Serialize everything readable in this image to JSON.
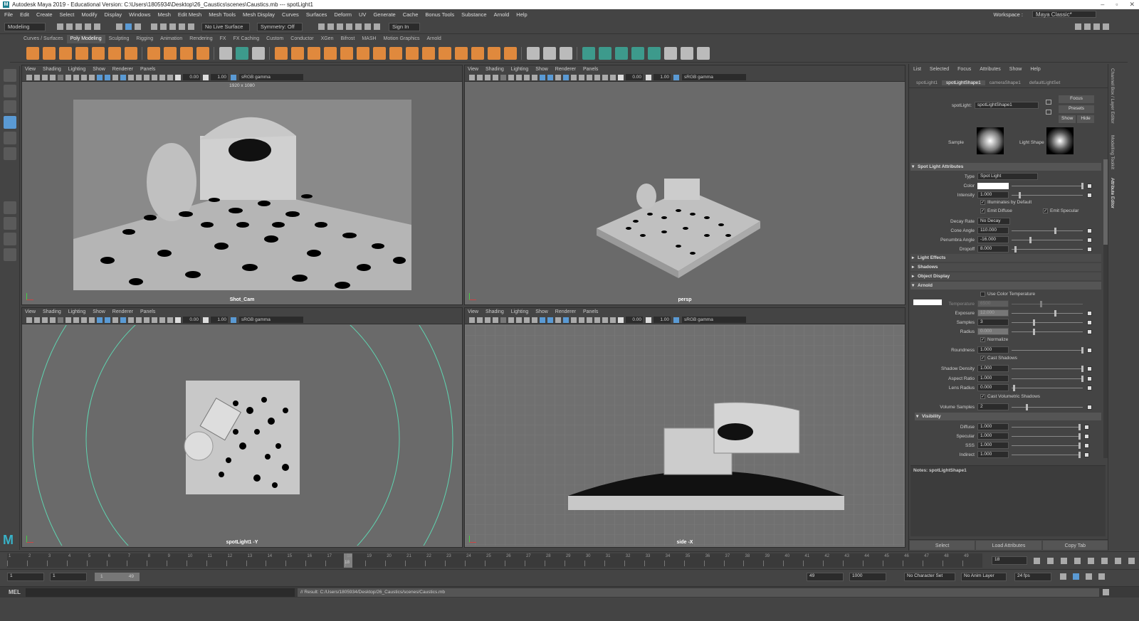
{
  "title": "Autodesk Maya 2019 - Educational Version: C:\\Users\\1805934\\Desktop\\26_Caustics\\scenes\\Caustics.mb  ---  spotLight1",
  "menus": [
    "File",
    "Edit",
    "Create",
    "Select",
    "Modify",
    "Display",
    "Windows",
    "Mesh",
    "Edit Mesh",
    "Mesh Tools",
    "Mesh Display",
    "Curves",
    "Surfaces",
    "Deform",
    "UV",
    "Generate",
    "Cache",
    "Bonus Tools",
    "Substance",
    "Arnold",
    "Help"
  ],
  "workspace": {
    "label": "Workspace :",
    "value": "Maya Classic*"
  },
  "status": {
    "mode": "Modeling",
    "live": "No Live Surface",
    "symmetry": "Symmetry: Off",
    "signin": "Sign In"
  },
  "shelf_tabs": [
    "Curves / Surfaces",
    "Poly Modeling",
    "Sculpting",
    "Rigging",
    "Animation",
    "Rendering",
    "FX",
    "FX Caching",
    "Custom",
    "Conductor",
    "XGen",
    "Bifrost",
    "MASH",
    "Motion Graphics",
    "Arnold"
  ],
  "viewport": {
    "menu": [
      "View",
      "Shading",
      "Lighting",
      "Show",
      "Renderer",
      "Panels"
    ],
    "value1": "0.00",
    "value2": "1.00",
    "gamma": "sRGB gamma",
    "panels": [
      {
        "label": "Shot_Cam",
        "res": "1920 x 1080"
      },
      {
        "label": "persp"
      },
      {
        "label": "spotLight1 -Y"
      },
      {
        "label": "side -X"
      }
    ]
  },
  "ae": {
    "menu": [
      "List",
      "Selected",
      "Focus",
      "Attributes",
      "Show",
      "Help"
    ],
    "tabs": [
      "spotLight1",
      "spotLightShape1",
      "cameraShape1",
      "defaultLightSet"
    ],
    "node_label": "spotLight:",
    "node_name": "spotLightShape1",
    "focus": "Focus",
    "presets": "Presets",
    "show": "Show",
    "hide": "Hide",
    "sample": "Sample",
    "light_shape": "Light Shape",
    "sections": {
      "spot": "Spot Light Attributes",
      "effects": "Light Effects",
      "shadows": "Shadows",
      "objdisp": "Object Display",
      "arnold": "Arnold",
      "visibility": "Visibility"
    },
    "type_label": "Type",
    "type_value": "Spot Light",
    "color_label": "Color",
    "intensity_label": "Intensity",
    "intensity_value": "1.000",
    "illum": "Illuminates by Default",
    "emit_diffuse": "Emit Diffuse",
    "emit_specular": "Emit Specular",
    "decay_label": "Decay Rate",
    "decay_value": "No Decay",
    "cone_label": "Cone Angle",
    "cone_value": "110.000",
    "penumbra_label": "Penumbra Angle",
    "penumbra_value": "-16.000",
    "dropoff_label": "Dropoff",
    "dropoff_value": "8.000",
    "use_color_temp": "Use Color Temperature",
    "temp_label": "Temperature",
    "temp_value": "6500",
    "exposure_label": "Exposure",
    "exposure_value": "12.000",
    "samples_label": "Samples",
    "samples_value": "3",
    "radius_label": "Radius",
    "radius_value": "0.000",
    "normalize": "Normalize",
    "roundness_label": "Roundness",
    "roundness_value": "1.000",
    "cast_shadows": "Cast Shadows",
    "shadow_density_label": "Shadow Density",
    "shadow_density_value": "1.000",
    "aspect_label": "Aspect Ratio",
    "aspect_value": "1.000",
    "lens_label": "Lens Radius",
    "lens_value": "0.000",
    "cast_vol": "Cast Volumetric Shadows",
    "vol_samples_label": "Volume Samples",
    "vol_samples_value": "2",
    "diffuse_label": "Diffuse",
    "diffuse_value": "1.000",
    "specular_label": "Specular",
    "specular_value": "1.000",
    "sss_label": "SSS",
    "sss_value": "1.000",
    "indirect_label": "Indirect",
    "indirect_value": "1.000",
    "notes": "Notes: spotLightShape1",
    "btn_select": "Select",
    "btn_load": "Load Attributes",
    "btn_copy": "Copy Tab"
  },
  "side_tabs": [
    "Channel Box / Layer Editor",
    "Modelling Toolkit",
    "Attribute Editor"
  ],
  "timeline": {
    "ticks": [
      "1",
      "2",
      "3",
      "4",
      "5",
      "6",
      "7",
      "8",
      "9",
      "10",
      "11",
      "12",
      "13",
      "14",
      "15",
      "16",
      "17",
      "18",
      "19",
      "20",
      "21",
      "22",
      "23",
      "24",
      "25",
      "26",
      "27",
      "28",
      "29",
      "30",
      "31",
      "32",
      "33",
      "34",
      "35",
      "36",
      "37",
      "38",
      "39",
      "40",
      "41",
      "42",
      "43",
      "44",
      "45",
      "46",
      "47",
      "48",
      "49"
    ],
    "current": 18,
    "current_label": "18",
    "frame_field": "18"
  },
  "range": {
    "start": "1",
    "start2": "1",
    "inner_start": "1",
    "inner_end": "49",
    "end": "49",
    "end2": "1000",
    "char_set": "No Character Set",
    "anim_layer": "No Anim Layer",
    "fps": "24 fps"
  },
  "cmd": {
    "lang": "MEL",
    "result": "// Result: C:/Users/1805934/Desktop/26_Caustics/scenes/Caustics.mb"
  },
  "colors": {
    "accent": "#5a9ad4",
    "shelf_orange": "#e0893d",
    "teal": "#3d9a8c",
    "helper_green": "#5fd4b0"
  }
}
